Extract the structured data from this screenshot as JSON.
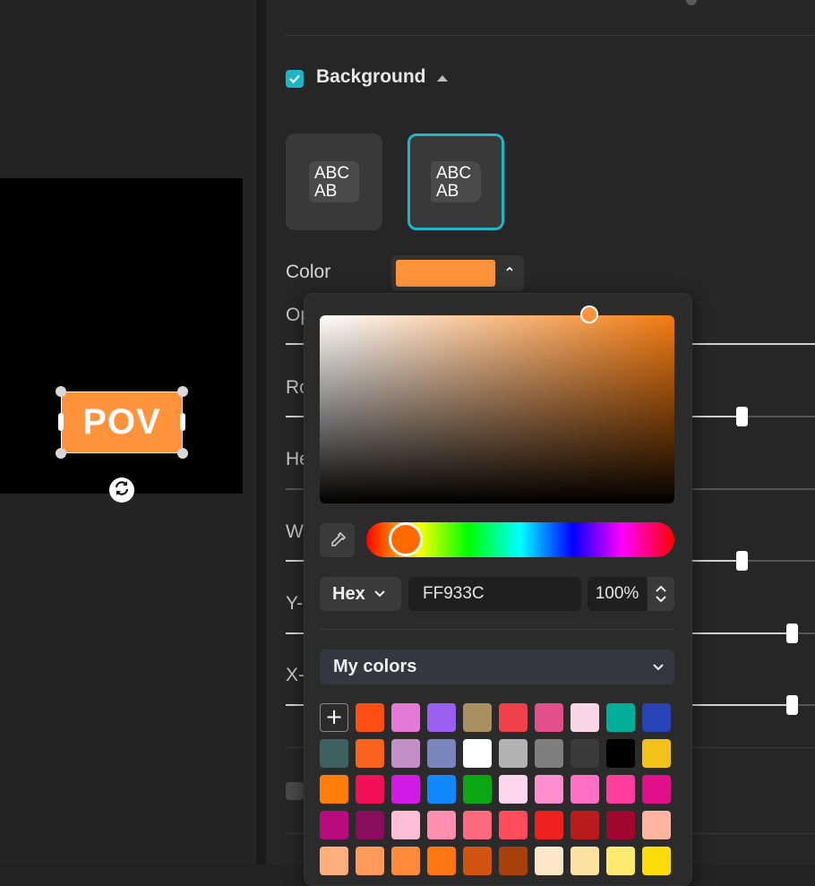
{
  "canvas": {
    "overlay_text": "POV",
    "overlay_color": "#FF933C"
  },
  "panel": {
    "section_title": "Background",
    "section_checked": true,
    "style_tiles": [
      {
        "line1": "ABC",
        "line2": "AB",
        "selected": false
      },
      {
        "line1": "ABC",
        "line2": "AB",
        "selected": true
      }
    ],
    "color_label": "Color",
    "color_value": "#FF933C",
    "properties": [
      {
        "label": "Opacity",
        "visible_label": "Op",
        "slider_value": 1.0
      },
      {
        "label": "Roundness",
        "visible_label": "Ro",
        "slider_value": 0.05
      },
      {
        "label": "Height",
        "visible_label": "He",
        "slider_value": 0.0
      },
      {
        "label": "Width",
        "visible_label": "W",
        "slider_value": 0.05
      },
      {
        "label": "Y-offset",
        "visible_label": "Y-",
        "slider_value": 0.5
      },
      {
        "label": "X-offset",
        "visible_label": "X-",
        "slider_value": 0.5
      }
    ],
    "accent_color": "#1fb5c6"
  },
  "picker": {
    "format": "Hex",
    "hex_value": "FF933C",
    "alpha_value": "100%",
    "palette_name": "My colors",
    "add_label": "+",
    "swatches": [
      "#ff4f12",
      "#e37ad7",
      "#9b5ff0",
      "#a89060",
      "#f0404a",
      "#e24f8a",
      "#f8d6e8",
      "#00ae9a",
      "#2643b8",
      "#3d6060",
      "#f8641e",
      "#c28fc6",
      "#7a84bd",
      "#ffffff",
      "#b3b3b3",
      "#7f7f7f",
      "#3a3a3a",
      "#000000",
      "#f2c21a",
      "#ff7e0a",
      "#f20f5a",
      "#d21ae6",
      "#1288ff",
      "#0aa614",
      "#fdd6ee",
      "#ff8fcf",
      "#ff6fc4",
      "#ff3d9d",
      "#e0108a",
      "#b80c7e",
      "#8a0c5c",
      "#ffbed6",
      "#ff8fb0",
      "#ff6a7e",
      "#ff4d5e",
      "#ef2020",
      "#b81c1c",
      "#a0062e",
      "#ffb5a0",
      "#ffae7e",
      "#ff9a5a",
      "#ff8a3a",
      "#ff7612",
      "#d15410",
      "#a8400c",
      "#fce8c8",
      "#fbe2a0",
      "#fde870",
      "#fcdc0a"
    ]
  }
}
